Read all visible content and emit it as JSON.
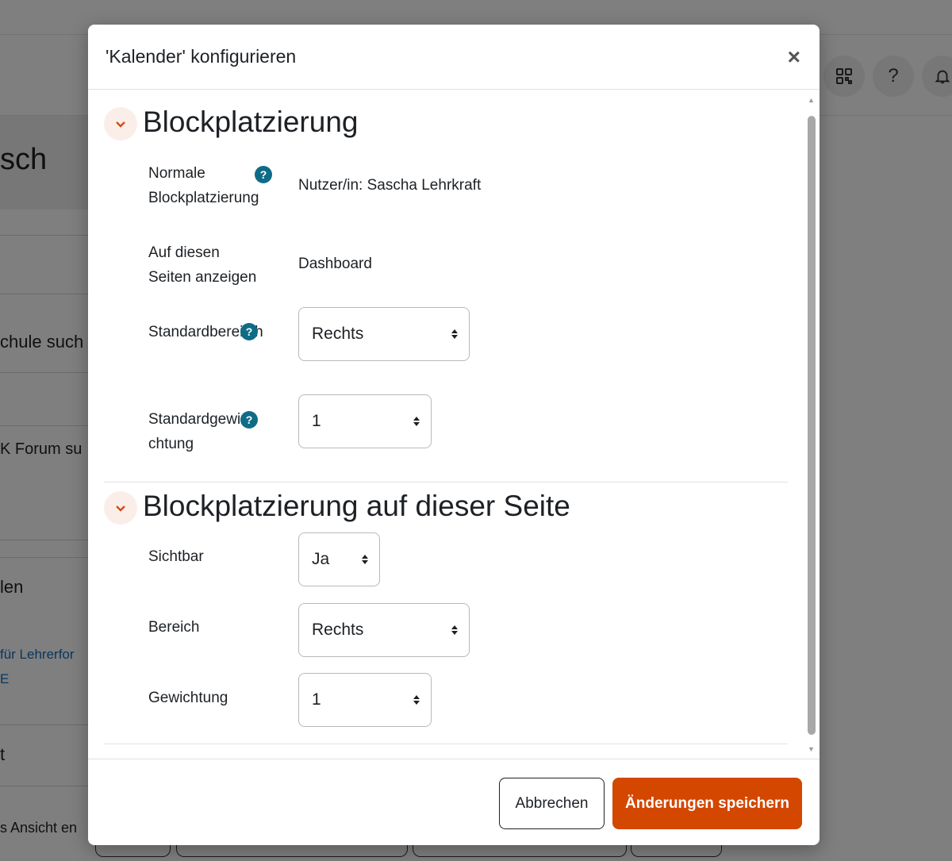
{
  "background": {
    "heading_fragment": "sch",
    "search_school_fragment": "chule such",
    "forum_fragment": "K Forum su",
    "section_fragment": "len",
    "link_fragment_1": "für Lehrerfor",
    "link_fragment_2": "E",
    "section_fragment_2": "t",
    "view_fragment": "s Ansicht en",
    "help_icon_glyph": "?"
  },
  "modal": {
    "title": "'Kalender' konfigurieren",
    "close_glyph": "×",
    "sections": [
      {
        "title": "Blockplatzierung",
        "fields": [
          {
            "label": "Normale Blockplatzierung",
            "value": "Nutzer/in: Sascha Lehrkraft",
            "help": true
          },
          {
            "label": "Auf diesen Seiten anzeigen",
            "value": "Dashboard",
            "help": false
          },
          {
            "label": "Standardbereich",
            "label_display": "Standardberei ch",
            "select": "Rechts",
            "help": true
          },
          {
            "label": "Standardgewichtung",
            "label_display": "Standardgewi chtung",
            "select": "1",
            "help": true
          }
        ]
      },
      {
        "title": "Blockplatzierung auf dieser Seite",
        "fields": [
          {
            "label": "Sichtbar",
            "select": "Ja"
          },
          {
            "label": "Bereich",
            "select": "Rechts"
          },
          {
            "label": "Gewichtung",
            "select": "1"
          }
        ]
      }
    ],
    "help_glyph": "?",
    "footer": {
      "cancel_label": "Abbrechen",
      "save_label": "Änderungen speichern"
    }
  },
  "colors": {
    "primary": "#d34700",
    "help_icon": "#0f6c87",
    "section_toggle": "#d34d1a"
  },
  "icons": [
    "qr-code-icon",
    "help-icon",
    "bell-icon",
    "close-icon",
    "chevron-down-icon",
    "help-circle-icon"
  ]
}
